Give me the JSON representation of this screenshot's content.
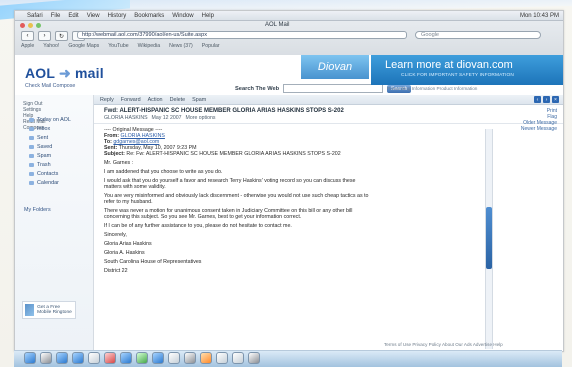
{
  "mac_menu": {
    "left_items": [
      "Safari",
      "File",
      "Edit",
      "View",
      "History",
      "Bookmarks",
      "Window",
      "Help"
    ],
    "right_items": [
      "Mon 10:43 PM"
    ]
  },
  "browser": {
    "window_title": "AOL Mail",
    "address": "http://webmail.aol.com/37990/aol/en-us/Suite.aspx",
    "search_placeholder": "Google",
    "bookmarks": [
      "Apple",
      "Yahoo!",
      "Google Maps",
      "YouTube",
      "Wikipedia",
      "News (37)",
      "Popular"
    ]
  },
  "aol": {
    "logo_left": "AOL",
    "logo_right": "mail",
    "account_line": "Check Mail   Compose",
    "search_label": "Search The Web",
    "search_button": "Search",
    "promo_brand": "Diovan",
    "promo_title": "Learn more at diovan.com",
    "promo_sub": "CLICK FOR IMPORTANT SAFETY INFORMATION",
    "promo_links": "Prescribing Information   Product Information"
  },
  "left_nav": {
    "top_text": [
      "Sign Out",
      "Settings",
      "Help",
      "Read Mail",
      "Compose"
    ],
    "folders": [
      "Today on AOL",
      "Inbox",
      "Sent",
      "Saved",
      "Spam",
      "Trash",
      "Contacts",
      "Calendar"
    ],
    "my_folders": "My Folders",
    "ad_text": "Get a Free Mobile Ringtone"
  },
  "message": {
    "toolbar": [
      "Reply",
      "Forward",
      "Action",
      "Delete",
      "Spam"
    ],
    "subject": "Fwd: ALERT-HISPANIC SC HOUSE MEMBER GLORIA ARIAS HASKINS STOPS S-202",
    "from": "GLORIA HASKINS",
    "date": "May 12 2007",
    "meta_extra": "More options",
    "right_links": [
      "Print",
      "Flag",
      "Older Message",
      "Newer Message"
    ],
    "original": {
      "heading": "---- Original Message ----",
      "from_label": "From:",
      "from_value": "GLORIA HASKINS",
      "to_label": "To:",
      "to_value": "gdgarnes@aol.com",
      "sent_label": "Sent:",
      "sent_value": "Thursday, May 10, 2007 9:23 PM",
      "subject_label": "Subject:",
      "subject_value": "Re: Fw: ALERT-HISPANIC SC HOUSE MEMBER GLORIA ARIAS HASKINS STOPS S-202"
    },
    "body": [
      "Mr. Garnes :",
      "I am saddened that you choose to write as you do.",
      "I would ask that you do yourself a favor and research Terry Haskins' voting record so you can discuss these matters with some validity.",
      "You are very misinformed and obviously lack discernment - otherwise you would not use such cheap tactics as to refer to my husband.",
      "There was never a motion for unanimous consent taken in Judiciary Committee on this bill or any other bill concerning this subject. So you see Mr. Garnes, best to get your information correct.",
      "If I can be of any further assistance to you, please do not hesitate to contact me.",
      "Sincerely,",
      "Gloria Arias Haskins",
      "Gloria A. Haskins",
      "South Carolina House of Representatives",
      "District 22"
    ]
  },
  "footer": {
    "links": "Terms of Use   Privacy Policy   About Our Ads   Advertise   Help"
  },
  "colors": {
    "accent": "#20509c",
    "promo": "#1d74b9",
    "link": "#2d5ea8"
  },
  "dock_icons": [
    "finder-icon",
    "dashboard-icon",
    "mail-icon",
    "ichat-icon",
    "address-book-icon",
    "calendar-icon",
    "itunes-icon",
    "iphoto-icon",
    "safari-icon",
    "preview-icon",
    "system-preferences-icon",
    "firefox-icon",
    "documents-icon",
    "downloads-icon",
    "trash-icon"
  ]
}
